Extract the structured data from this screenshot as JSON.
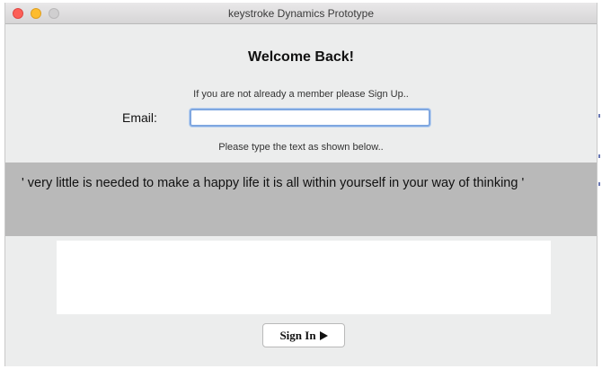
{
  "window": {
    "title": "keystroke Dynamics Prototype"
  },
  "login": {
    "heading": "Welcome Back!",
    "signup_prompt": "If you are not already a member please Sign Up..",
    "email_label": "Email:",
    "email_value": "",
    "instruction": "Please type the text as shown below..",
    "phrase": "'  very little is needed to make a happy life it is all within yourself in your way of thinking  '",
    "typing_value": "",
    "signin_label": "Sign In"
  },
  "icons": {
    "close": "close-icon",
    "minimize": "minimize-icon",
    "maximize": "maximize-icon",
    "signin_arrow": "play-arrow-icon"
  },
  "colors": {
    "window_bg": "#eceded",
    "phrase_panel_bg": "#b9b9b9",
    "focus_ring": "#7fa7e0",
    "close": "#fc5f57",
    "minimize": "#fdbc2e",
    "maximize": "#d0cfd0"
  }
}
